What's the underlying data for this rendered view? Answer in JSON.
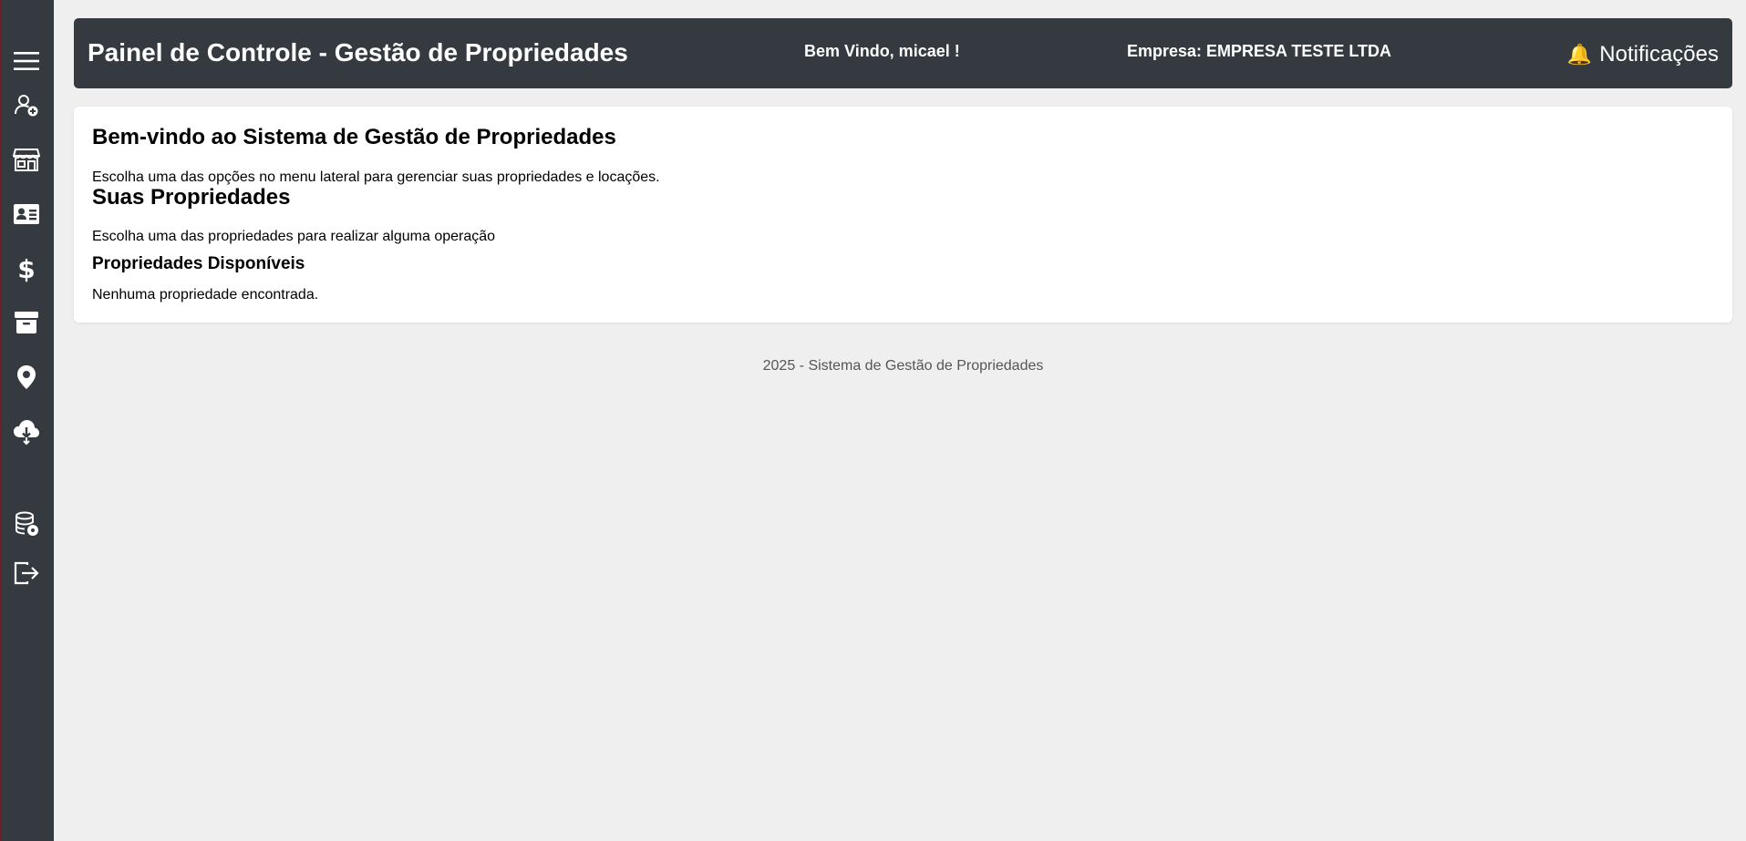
{
  "header": {
    "title": "Painel de Controle - Gestão de Propriedades",
    "welcome": "Bem Vindo, micael !",
    "company": "Empresa: EMPRESA TESTE LTDA",
    "notifications_label": "Notificações",
    "notifications_icon": "bell-icon"
  },
  "sidebar": {
    "items": [
      {
        "icon": "menu-icon"
      },
      {
        "icon": "add-user-icon"
      },
      {
        "icon": "store-icon"
      },
      {
        "icon": "id-card-icon"
      },
      {
        "icon": "dollar-icon"
      },
      {
        "icon": "archive-icon"
      },
      {
        "icon": "map-pin-icon"
      },
      {
        "icon": "cloud-download-icon"
      },
      {
        "icon": "database-settings-icon"
      },
      {
        "icon": "logout-icon"
      }
    ]
  },
  "main": {
    "heading": "Bem-vindo ao Sistema de Gestão de Propriedades",
    "intro": "Escolha uma das opções no menu lateral para gerenciar suas propriedades e locações.",
    "properties_heading": "Suas Propriedades",
    "properties_intro": "Escolha uma das propriedades para realizar alguma operação",
    "available_heading": "Propriedades Disponíveis",
    "empty_message": "Nenhuma propriedade encontrada."
  },
  "footer": {
    "text": "2025 - Sistema de Gestão de Propriedades"
  },
  "colors": {
    "sidebar_bg": "#343a40",
    "header_bg": "#343a40",
    "page_bg": "#efefef",
    "bell": "#f5b301"
  }
}
